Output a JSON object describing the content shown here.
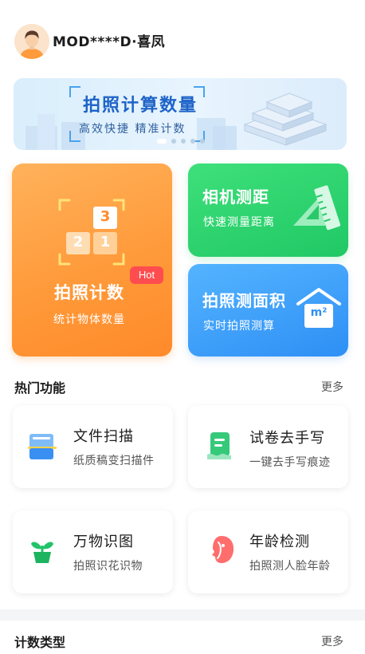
{
  "header": {
    "username": "MOD****D·喜凤"
  },
  "banner": {
    "title": "拍照计算数量",
    "subtitle": "高效快捷 精准计数",
    "page_count": 5,
    "active_page": 0
  },
  "main_cards": {
    "count": {
      "title": "拍照计数",
      "subtitle": "统计物体数量",
      "badge": "Hot",
      "icon_numbers": [
        "3",
        "2",
        "1"
      ]
    },
    "distance": {
      "title": "相机测距",
      "subtitle": "快速测量距离"
    },
    "area": {
      "title": "拍照测面积",
      "subtitle": "实时拍照测算",
      "icon_label": "m²"
    }
  },
  "hot_section": {
    "title": "热门功能",
    "more": "更多",
    "items": [
      {
        "title": "文件扫描",
        "subtitle": "纸质稿变扫描件"
      },
      {
        "title": "试卷去手写",
        "subtitle": "一键去手写痕迹"
      },
      {
        "title": "万物识图",
        "subtitle": "拍照识花识物"
      },
      {
        "title": "年龄检测",
        "subtitle": "拍照测人脸年龄"
      }
    ]
  },
  "count_section": {
    "title": "计数类型",
    "more": "更多"
  },
  "colors": {
    "orange": "#ff9a3a",
    "green": "#20c865",
    "blue": "#2e8ff5",
    "hot_red": "#ff4d4f"
  }
}
